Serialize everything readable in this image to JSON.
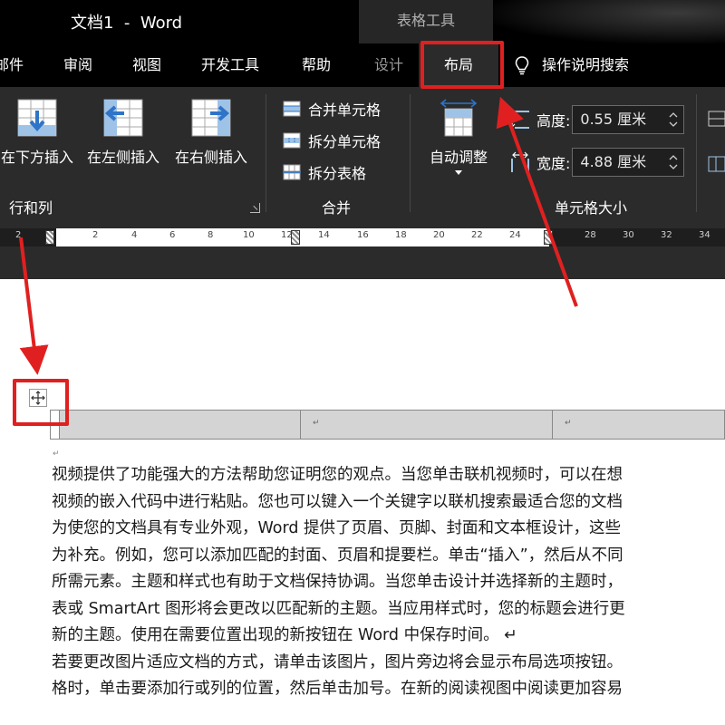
{
  "titlebar": {
    "title": "文档1  -  Word",
    "context_tab": "表格工具"
  },
  "tabs": [
    {
      "label": "邮件"
    },
    {
      "label": "审阅"
    },
    {
      "label": "视图"
    },
    {
      "label": "开发工具"
    },
    {
      "label": "帮助"
    },
    {
      "label": "设计"
    },
    {
      "label": "布局"
    },
    {
      "label": "操作说明搜索"
    }
  ],
  "ribbon": {
    "rows_cols": {
      "insert_below": "在下方插入",
      "insert_left": "在左侧插入",
      "insert_right": "在右侧插入",
      "group_label": "行和列"
    },
    "merge": {
      "merge_cells": "合并单元格",
      "split_cells": "拆分单元格",
      "split_table": "拆分表格",
      "group_label": "合并"
    },
    "cell_size": {
      "autofit": "自动调整",
      "height_label": "高度:",
      "height_value": "0.55 厘米",
      "width_label": "宽度:",
      "width_value": "4.88 厘米",
      "group_label": "单元格大小"
    }
  },
  "ruler": {
    "ticks": [
      "2",
      "2",
      "4",
      "6",
      "8",
      "10",
      "12",
      "14",
      "16",
      "18",
      "20",
      "22",
      "24",
      "28",
      "30",
      "32",
      "34"
    ]
  },
  "document": {
    "cell_marks": [
      "↵",
      "↵"
    ],
    "paragraph_mark": "↵",
    "lines": [
      "视频提供了功能强大的方法帮助您证明您的观点。当您单击联机视频时，可以在想",
      "视频的嵌入代码中进行粘贴。您也可以键入一个关键字以联机搜索最适合您的文档",
      "为使您的文档具有专业外观，Word 提供了页眉、页脚、封面和文本框设计，这些",
      "为补充。例如，您可以添加匹配的封面、页眉和提要栏。单击“插入”，然后从不同",
      "所需元素。主题和样式也有助于文档保持协调。当您单击设计并选择新的主题时，",
      "表或 SmartArt 图形将会更改以匹配新的主题。当应用样式时，您的标题会进行更",
      "新的主题。使用在需要位置出现的新按钮在 Word 中保存时间。 ↵",
      "若要更改图片适应文档的方式，请单击该图片，图片旁边将会显示布局选项按钮。",
      "格时，单击要添加行或列的位置，然后单击加号。在新的阅读视图中阅读更加容易"
    ]
  },
  "colors": {
    "highlight": "#e02020",
    "ribbon_bg": "#2b2b2b",
    "titlebar_bg": "#000000"
  }
}
